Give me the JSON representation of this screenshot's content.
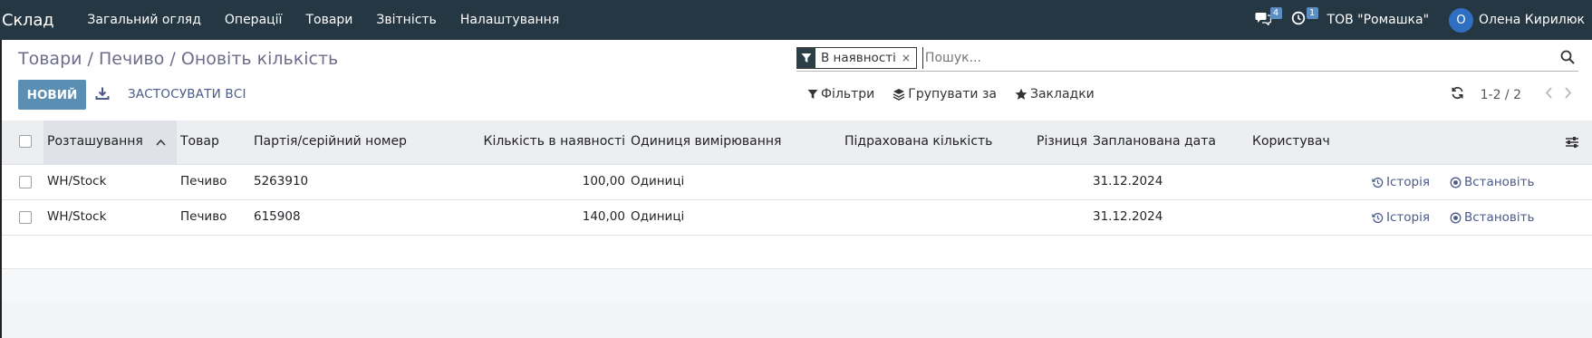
{
  "app": {
    "brand": "Склад",
    "menu": [
      "Загальний огляд",
      "Операції",
      "Товари",
      "Звітність",
      "Налаштування"
    ],
    "messages_count": "4",
    "activities_count": "1",
    "company": "ТОВ \"Ромашка\"",
    "user_initial": "О",
    "user_name": "Олена Кирилюк"
  },
  "breadcrumb": {
    "part1": "Товари",
    "part2": "Печиво",
    "part3": "Оновіть кількість",
    "separator": "/"
  },
  "toolbar": {
    "new_label": "НОВИЙ",
    "apply_all_label": "ЗАСТОСУВАТИ ВСІ"
  },
  "search": {
    "facet_label": "В наявності",
    "facet_close": "×",
    "placeholder": "Пошук..."
  },
  "filters": {
    "filters_label": "Фільтри",
    "group_by_label": "Групувати за",
    "favorites_label": "Закладки"
  },
  "pager": {
    "value": "1-2 / 2",
    "prev": "‹",
    "next": "›"
  },
  "table": {
    "columns": {
      "location": "Розташування",
      "product": "Товар",
      "lot": "Партія/серійний номер",
      "on_hand": "Кількість в наявності",
      "uom": "Одиниця вимірювання",
      "counted": "Підрахована кількість",
      "difference": "Різниця",
      "scheduled_date": "Запланована дата",
      "user": "Користувач"
    },
    "rows": [
      {
        "location": "WH/Stock",
        "product": "Печиво",
        "lot": "5263910",
        "on_hand": "100,00",
        "uom": "Одиниці",
        "counted": "",
        "difference": "",
        "scheduled_date": "31.12.2024",
        "user": "",
        "history_label": "Історія",
        "set_label": "Встановіть"
      },
      {
        "location": "WH/Stock",
        "product": "Печиво",
        "lot": "615908",
        "on_hand": "140,00",
        "uom": "Одиниці",
        "counted": "",
        "difference": "",
        "scheduled_date": "31.12.2024",
        "user": "",
        "history_label": "Історія",
        "set_label": "Встановіть"
      }
    ]
  },
  "colors": {
    "topbar": "#243742",
    "primary_button": "#5a8fb3",
    "link": "#4b5a8a",
    "header_bg": "#eceef2",
    "avatar": "#2f6fc2"
  },
  "icons": {
    "messages": "chat-bubbles-icon",
    "activities": "clock-icon",
    "download": "download-icon",
    "facet": "filter-funnel-icon",
    "search": "magnifier-icon",
    "filters": "funnel-icon",
    "group_by": "layers-icon",
    "favorites": "star-icon",
    "refresh": "refresh-icon",
    "sort": "chevron-up-icon",
    "optional_columns": "sliders-icon",
    "history": "history-icon",
    "set": "target-icon"
  }
}
